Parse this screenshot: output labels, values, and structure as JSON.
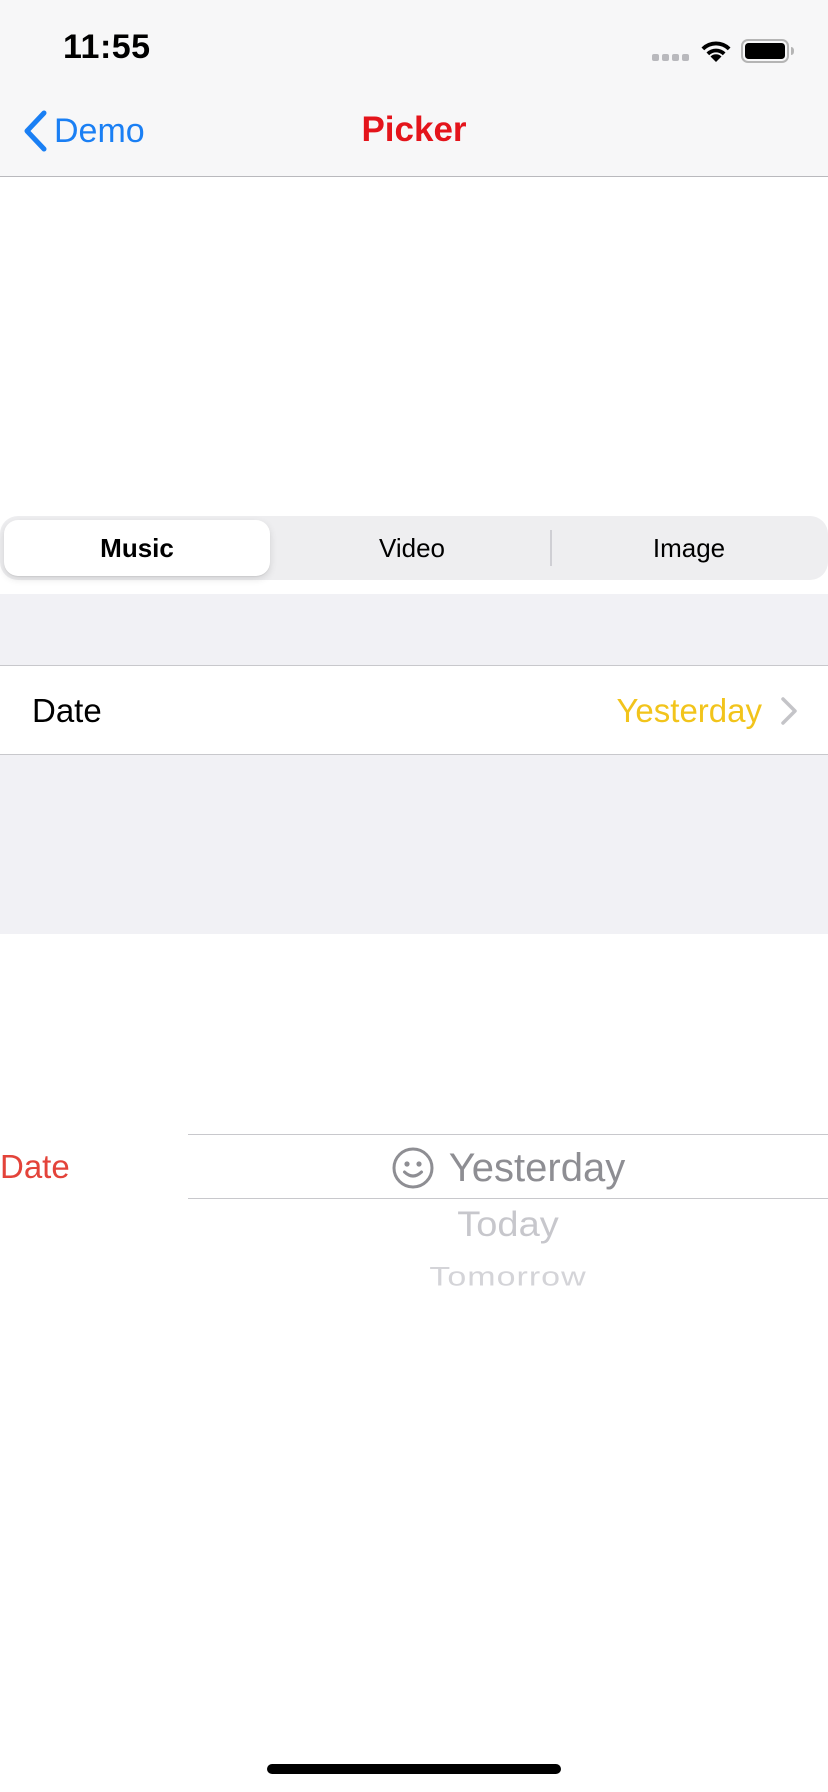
{
  "status_bar": {
    "time": "11:55"
  },
  "nav": {
    "back_label": "Demo",
    "title": "Picker"
  },
  "segmented_control": {
    "segments": [
      "Music",
      "Video",
      "Image"
    ],
    "selected": "Music"
  },
  "table": {
    "row_label": "Date",
    "row_value": "Yesterday"
  },
  "picker": {
    "label": "Date",
    "options": [
      "Yesterday",
      "Today",
      "Tomorrow"
    ],
    "selected": "Yesterday"
  },
  "colors": {
    "nav_title": "#e4141b",
    "back_link": "#1a7ff4",
    "row_value": "#f2c41b",
    "picker_label": "#e3433a",
    "picker_selected_text": "#8e8e93",
    "grouped_background": "#f1f1f5"
  },
  "icons": {
    "back": "chevron-left-icon",
    "row_disclosure": "chevron-right-icon",
    "picker_option": "smiley-face-icon",
    "wifi": "wifi-icon",
    "battery": "battery-icon",
    "cellular": "cellular-signal-icon"
  }
}
